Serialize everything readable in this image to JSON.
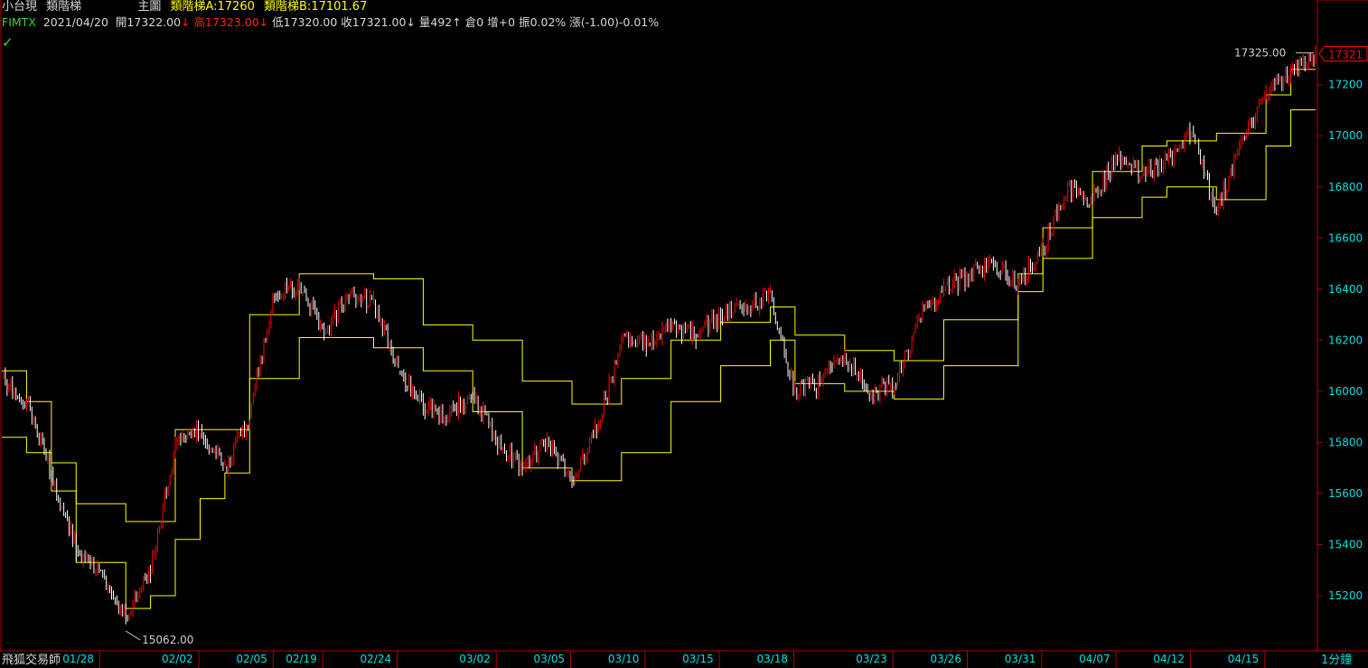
{
  "header": {
    "title": "小台現",
    "indicator_name": "類階梯",
    "panel_label": "主圖",
    "ind_a": "類階梯A:17260",
    "ind_b": "類階梯B:17101.67",
    "symbol": "FIMTX",
    "date": "2021/04/20",
    "open": "開17322.00",
    "high": "高17323.00",
    "low": "低17320.00",
    "close": "收17321.00",
    "volume": "量492",
    "oi": "倉0",
    "oi_change": "增+0",
    "amplitude": "振0.02%",
    "change": "漲(-1.00)-0.01%",
    "arrow_down": "↓",
    "arrow_up": "↑",
    "check_mark": "✓"
  },
  "footer": {
    "brand": "飛狐交易師",
    "interval": "1分鐘"
  },
  "colors": {
    "background": "#000000",
    "axis": "#b00000",
    "ladder": "#ffff00",
    "candle_up": "#ff0000",
    "candle_down": "#ffffff",
    "price_tag": "#ff0000",
    "y_labels": "#00e0e0"
  },
  "chart_data": {
    "type": "candlestick_line",
    "title": "",
    "x_ticks": [
      "01/28",
      "02/02",
      "02/05",
      "02/19",
      "02/24",
      "03/02",
      "03/05",
      "03/10",
      "03/15",
      "03/18",
      "03/23",
      "03/26",
      "03/31",
      "04/07",
      "04/12",
      "04/15"
    ],
    "y_ticks": [
      15200,
      15400,
      15600,
      15800,
      16000,
      16200,
      16400,
      16600,
      16800,
      17000,
      17200
    ],
    "ylim": [
      15062,
      17390
    ],
    "last_price": 17321,
    "max_label": "17325.00",
    "min_label": "15062.00",
    "price_path": [
      {
        "d": "01/25",
        "v": 16050
      },
      {
        "d": "01/26",
        "v": 15960
      },
      {
        "d": "01/27",
        "v": 15680
      },
      {
        "d": "01/28",
        "v": 15380
      },
      {
        "d": "01/29",
        "v": 15300
      },
      {
        "d": "01/30",
        "v": 15120
      },
      {
        "d": "02/01",
        "v": 15300
      },
      {
        "d": "02/02",
        "v": 15780
      },
      {
        "d": "02/03",
        "v": 15850
      },
      {
        "d": "02/04",
        "v": 15700
      },
      {
        "d": "02/05",
        "v": 15900
      },
      {
        "d": "02/06",
        "v": 16380
      },
      {
        "d": "02/19",
        "v": 16420
      },
      {
        "d": "02/20",
        "v": 16220
      },
      {
        "d": "02/22",
        "v": 16380
      },
      {
        "d": "02/24",
        "v": 16350
      },
      {
        "d": "02/25",
        "v": 16080
      },
      {
        "d": "02/26",
        "v": 15950
      },
      {
        "d": "03/01",
        "v": 15900
      },
      {
        "d": "03/02",
        "v": 16000
      },
      {
        "d": "03/03",
        "v": 15800
      },
      {
        "d": "03/04",
        "v": 15700
      },
      {
        "d": "03/05",
        "v": 15800
      },
      {
        "d": "03/08",
        "v": 15650
      },
      {
        "d": "03/09",
        "v": 15850
      },
      {
        "d": "03/10",
        "v": 16200
      },
      {
        "d": "03/11",
        "v": 16180
      },
      {
        "d": "03/12",
        "v": 16250
      },
      {
        "d": "03/15",
        "v": 16220
      },
      {
        "d": "03/16",
        "v": 16300
      },
      {
        "d": "03/17",
        "v": 16320
      },
      {
        "d": "03/18",
        "v": 16380
      },
      {
        "d": "03/19",
        "v": 16000
      },
      {
        "d": "03/20",
        "v": 16030
      },
      {
        "d": "03/22",
        "v": 16150
      },
      {
        "d": "03/23",
        "v": 15980
      },
      {
        "d": "03/24",
        "v": 16030
      },
      {
        "d": "03/25",
        "v": 16280
      },
      {
        "d": "03/26",
        "v": 16400
      },
      {
        "d": "03/29",
        "v": 16450
      },
      {
        "d": "03/30",
        "v": 16500
      },
      {
        "d": "03/31",
        "v": 16420
      },
      {
        "d": "04/01",
        "v": 16560
      },
      {
        "d": "04/06",
        "v": 16800
      },
      {
        "d": "04/07",
        "v": 16750
      },
      {
        "d": "04/08",
        "v": 16920
      },
      {
        "d": "04/09",
        "v": 16850
      },
      {
        "d": "04/12",
        "v": 16900
      },
      {
        "d": "04/13",
        "v": 17020
      },
      {
        "d": "04/14",
        "v": 16700
      },
      {
        "d": "04/15",
        "v": 16980
      },
      {
        "d": "04/16",
        "v": 17150
      },
      {
        "d": "04/19",
        "v": 17250
      },
      {
        "d": "04/20",
        "v": 17321
      }
    ],
    "ladder_a": [
      {
        "from": "01/25",
        "to": "01/26",
        "v": 16080
      },
      {
        "from": "01/26",
        "to": "01/27",
        "v": 15960
      },
      {
        "from": "01/27",
        "to": "01/28",
        "v": 15720
      },
      {
        "from": "01/28",
        "to": "01/30",
        "v": 15560
      },
      {
        "from": "01/30",
        "to": "02/02",
        "v": 15490
      },
      {
        "from": "02/02",
        "to": "02/03",
        "v": 15850
      },
      {
        "from": "02/03",
        "to": "02/05",
        "v": 15850
      },
      {
        "from": "02/05",
        "to": "02/19",
        "v": 16300
      },
      {
        "from": "02/19",
        "to": "02/24",
        "v": 16460
      },
      {
        "from": "02/24",
        "to": "02/26",
        "v": 16440
      },
      {
        "from": "02/26",
        "to": "03/02",
        "v": 16260
      },
      {
        "from": "03/02",
        "to": "03/04",
        "v": 16200
      },
      {
        "from": "03/04",
        "to": "03/08",
        "v": 16040
      },
      {
        "from": "03/08",
        "to": "03/10",
        "v": 15950
      },
      {
        "from": "03/10",
        "to": "03/12",
        "v": 16050
      },
      {
        "from": "03/12",
        "to": "03/16",
        "v": 16200
      },
      {
        "from": "03/16",
        "to": "03/18",
        "v": 16270
      },
      {
        "from": "03/18",
        "to": "03/19",
        "v": 16330
      },
      {
        "from": "03/19",
        "to": "03/22",
        "v": 16220
      },
      {
        "from": "03/22",
        "to": "03/24",
        "v": 16160
      },
      {
        "from": "03/24",
        "to": "03/26",
        "v": 16120
      },
      {
        "from": "03/26",
        "to": "03/31",
        "v": 16280
      },
      {
        "from": "03/31",
        "to": "04/01",
        "v": 16460
      },
      {
        "from": "04/01",
        "to": "04/07",
        "v": 16640
      },
      {
        "from": "04/07",
        "to": "04/09",
        "v": 16860
      },
      {
        "from": "04/09",
        "to": "04/12",
        "v": 16960
      },
      {
        "from": "04/12",
        "to": "04/14",
        "v": 16980
      },
      {
        "from": "04/14",
        "to": "04/16",
        "v": 17010
      },
      {
        "from": "04/16",
        "to": "04/19",
        "v": 17160
      },
      {
        "from": "04/19",
        "to": "04/20",
        "v": 17260
      }
    ],
    "ladder_b": [
      {
        "from": "01/25",
        "to": "01/26",
        "v": 15820
      },
      {
        "from": "01/26",
        "to": "01/27",
        "v": 15760
      },
      {
        "from": "01/27",
        "to": "01/28",
        "v": 15610
      },
      {
        "from": "01/28",
        "to": "01/30",
        "v": 15330
      },
      {
        "from": "01/30",
        "to": "02/01",
        "v": 15150
      },
      {
        "from": "02/01",
        "to": "02/02",
        "v": 15200
      },
      {
        "from": "02/02",
        "to": "02/03",
        "v": 15420
      },
      {
        "from": "02/03",
        "to": "02/04",
        "v": 15580
      },
      {
        "from": "02/04",
        "to": "02/05",
        "v": 15680
      },
      {
        "from": "02/05",
        "to": "02/19",
        "v": 16050
      },
      {
        "from": "02/19",
        "to": "02/24",
        "v": 16210
      },
      {
        "from": "02/24",
        "to": "02/26",
        "v": 16170
      },
      {
        "from": "02/26",
        "to": "03/02",
        "v": 16080
      },
      {
        "from": "03/02",
        "to": "03/04",
        "v": 15920
      },
      {
        "from": "03/04",
        "to": "03/08",
        "v": 15700
      },
      {
        "from": "03/08",
        "to": "03/10",
        "v": 15650
      },
      {
        "from": "03/10",
        "to": "03/12",
        "v": 15760
      },
      {
        "from": "03/12",
        "to": "03/16",
        "v": 15960
      },
      {
        "from": "03/16",
        "to": "03/18",
        "v": 16100
      },
      {
        "from": "03/18",
        "to": "03/19",
        "v": 16200
      },
      {
        "from": "03/19",
        "to": "03/22",
        "v": 16030
      },
      {
        "from": "03/22",
        "to": "03/24",
        "v": 16000
      },
      {
        "from": "03/24",
        "to": "03/26",
        "v": 15970
      },
      {
        "from": "03/26",
        "to": "03/31",
        "v": 16100
      },
      {
        "from": "03/31",
        "to": "04/01",
        "v": 16390
      },
      {
        "from": "04/01",
        "to": "04/07",
        "v": 16520
      },
      {
        "from": "04/07",
        "to": "04/09",
        "v": 16680
      },
      {
        "from": "04/09",
        "to": "04/12",
        "v": 16760
      },
      {
        "from": "04/12",
        "to": "04/14",
        "v": 16800
      },
      {
        "from": "04/14",
        "to": "04/16",
        "v": 16750
      },
      {
        "from": "04/16",
        "to": "04/19",
        "v": 16960
      },
      {
        "from": "04/19",
        "to": "04/20",
        "v": 17101.67
      }
    ]
  }
}
